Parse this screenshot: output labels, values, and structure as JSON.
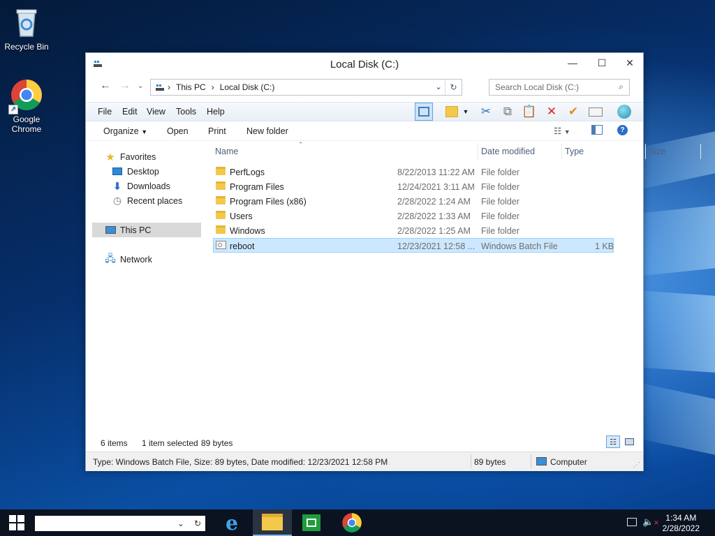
{
  "desktop": {
    "icons": [
      {
        "label": "Recycle Bin"
      },
      {
        "label": "Google Chrome"
      }
    ]
  },
  "window": {
    "title": "Local Disk (C:)",
    "controls": {
      "minimize": "—",
      "maximize": "☐",
      "close": "✕"
    },
    "address": {
      "segments": [
        "This PC",
        "Local Disk (C:)"
      ],
      "separator": "›"
    },
    "search_placeholder": "Search Local Disk (C:)",
    "menu": [
      "File",
      "Edit",
      "View",
      "Tools",
      "Help"
    ],
    "commands": {
      "organize": "Organize",
      "open": "Open",
      "print": "Print",
      "new_folder": "New folder"
    },
    "nav_pane": {
      "favorites": "Favorites",
      "desktop": "Desktop",
      "downloads": "Downloads",
      "recent": "Recent places",
      "this_pc": "This PC",
      "network": "Network"
    },
    "columns": {
      "name": "Name",
      "date": "Date modified",
      "type": "Type",
      "size": "Size"
    },
    "files": [
      {
        "name": "PerfLogs",
        "date": "8/22/2013 11:22 AM",
        "type": "File folder",
        "size": ""
      },
      {
        "name": "Program Files",
        "date": "12/24/2021 3:11 AM",
        "type": "File folder",
        "size": ""
      },
      {
        "name": "Program Files (x86)",
        "date": "2/28/2022 1:24 AM",
        "type": "File folder",
        "size": ""
      },
      {
        "name": "Users",
        "date": "2/28/2022 1:33 AM",
        "type": "File folder",
        "size": ""
      },
      {
        "name": "Windows",
        "date": "2/28/2022 1:25 AM",
        "type": "File folder",
        "size": ""
      },
      {
        "name": "reboot",
        "date": "12/23/2021 12:58 ...",
        "type": "Windows Batch File",
        "size": "1 KB"
      }
    ],
    "summary": {
      "items": "6 items",
      "selected": "1 item selected",
      "bytes": "89 bytes"
    },
    "status": {
      "details": "Type: Windows Batch File, Size: 89 bytes, Date modified: 12/23/2021 12:58 PM",
      "size": "89 bytes",
      "location": "Computer"
    }
  },
  "taskbar": {
    "time": "1:34 AM",
    "date": "2/28/2022"
  },
  "colors": {
    "selection": "#cce8ff",
    "selection_border": "#99d1ff",
    "taskbar": "#0b1320"
  }
}
